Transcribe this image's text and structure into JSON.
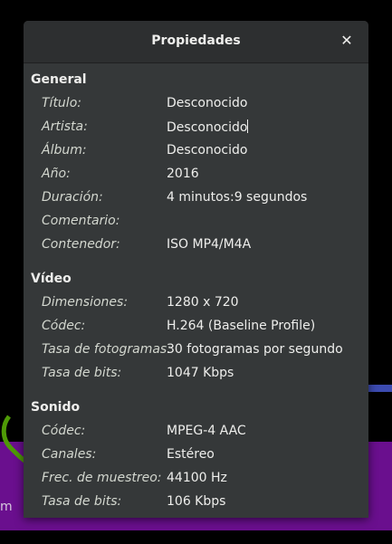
{
  "dialog": {
    "title": "Propiedades"
  },
  "background": {
    "partial_text": "m"
  },
  "general": {
    "title": "General",
    "rows": [
      {
        "label": "Título:",
        "value": "Desconocido"
      },
      {
        "label": "Artista:",
        "value": "Desconocido"
      },
      {
        "label": "Álbum:",
        "value": "Desconocido"
      },
      {
        "label": "Año:",
        "value": "2016"
      },
      {
        "label": "Duración:",
        "value": "4 minutos:9 segundos"
      },
      {
        "label": "Comentario:",
        "value": ""
      },
      {
        "label": "Contenedor:",
        "value": "ISO MP4/M4A"
      }
    ]
  },
  "video": {
    "title": "Vídeo",
    "rows": [
      {
        "label": "Dimensiones:",
        "value": "1280 x 720"
      },
      {
        "label": "Códec:",
        "value": "H.264 (Baseline Profile)"
      },
      {
        "label": "Tasa de fotogramas:",
        "value": "30 fotogramas por segundo"
      },
      {
        "label": "Tasa de bits:",
        "value": "1047 Kbps"
      }
    ]
  },
  "sound": {
    "title": "Sonido",
    "rows": [
      {
        "label": "Códec:",
        "value": "MPEG-4 AAC"
      },
      {
        "label": "Canales:",
        "value": "Estéreo"
      },
      {
        "label": "Frec. de muestreo:",
        "value": "44100 Hz"
      },
      {
        "label": "Tasa de bits:",
        "value": "106 Kbps"
      }
    ]
  }
}
